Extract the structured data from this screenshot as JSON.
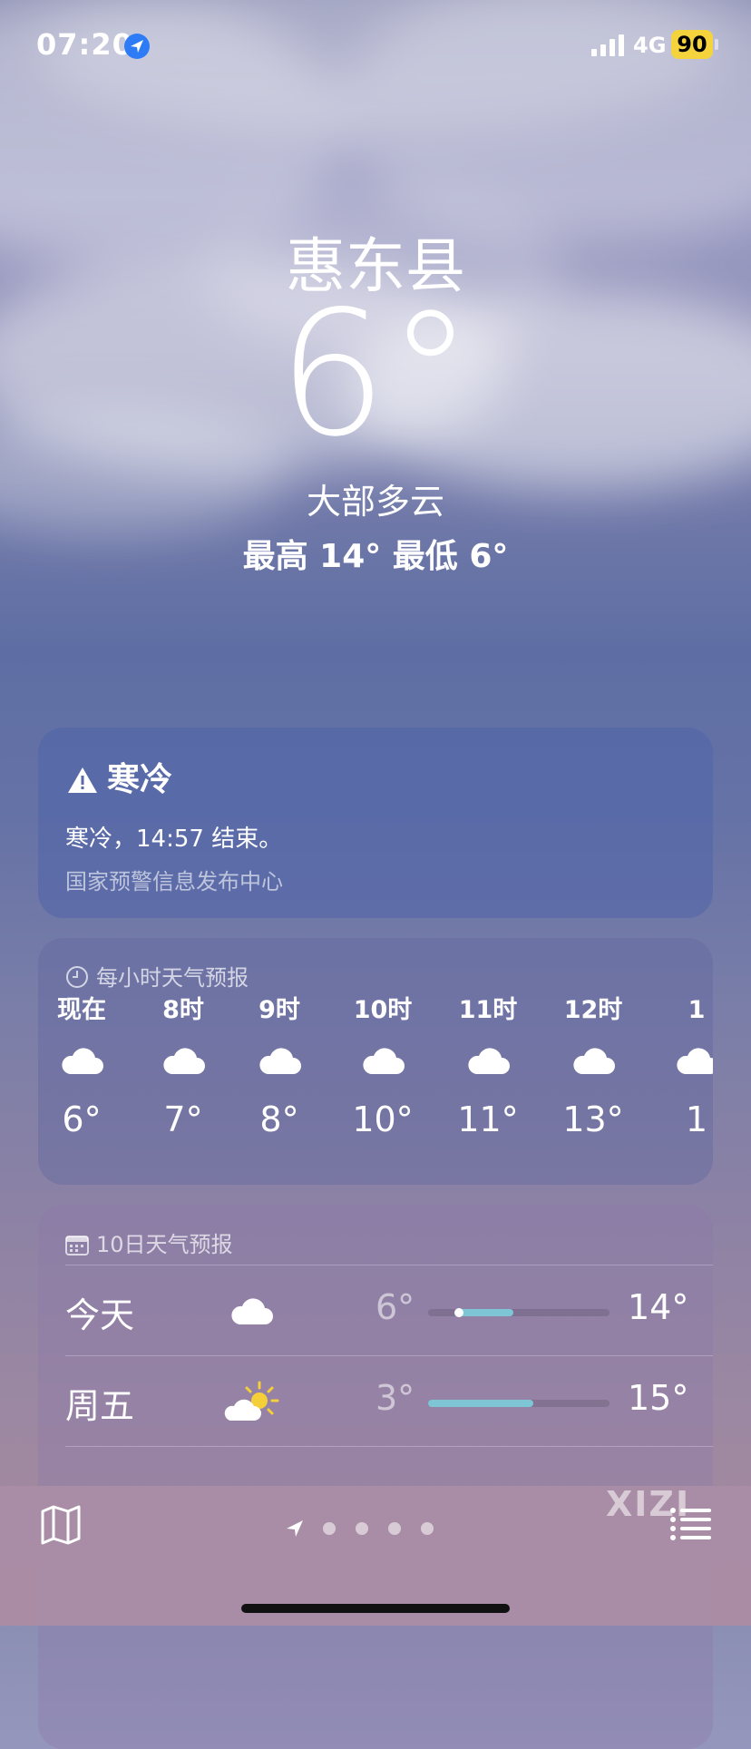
{
  "status": {
    "time": "07:20",
    "network": "4G",
    "battery": "90"
  },
  "weather": {
    "city": "惠东县",
    "temperature": "6°",
    "condition": "大部多云",
    "high_low": "最高 14°  最低 6°"
  },
  "alert": {
    "title": "寒冷",
    "body": "寒冷，14:57 结束。",
    "source": "国家预警信息发布中心"
  },
  "hourly": {
    "header": "每小时天气预报",
    "items": [
      {
        "label": "现在",
        "icon": "cloud-icon",
        "temp": "6°"
      },
      {
        "label": "8时",
        "icon": "cloud-icon",
        "temp": "7°"
      },
      {
        "label": "9时",
        "icon": "cloud-icon",
        "temp": "8°"
      },
      {
        "label": "10时",
        "icon": "cloud-icon",
        "temp": "10°"
      },
      {
        "label": "11时",
        "icon": "cloud-icon",
        "temp": "11°"
      },
      {
        "label": "12时",
        "icon": "cloud-icon",
        "temp": "13°"
      },
      {
        "label": "1",
        "icon": "cloud-icon",
        "temp": "1"
      }
    ]
  },
  "daily": {
    "header": "10日天气预报",
    "items": [
      {
        "name": "今天",
        "icon": "cloud-icon",
        "low": "6°",
        "high": "14°",
        "range": [
          0.17,
          0.47
        ],
        "current": 0.17
      },
      {
        "name": "周五",
        "icon": "partly-sunny-icon",
        "low": "3°",
        "high": "15°",
        "range": [
          0.0,
          0.58
        ]
      }
    ]
  },
  "tabbar": {
    "watermark": "XIZI",
    "page_count": 5
  },
  "colors": {
    "bar_fill": "#7ec6d6",
    "battery": "#f5d33c"
  }
}
